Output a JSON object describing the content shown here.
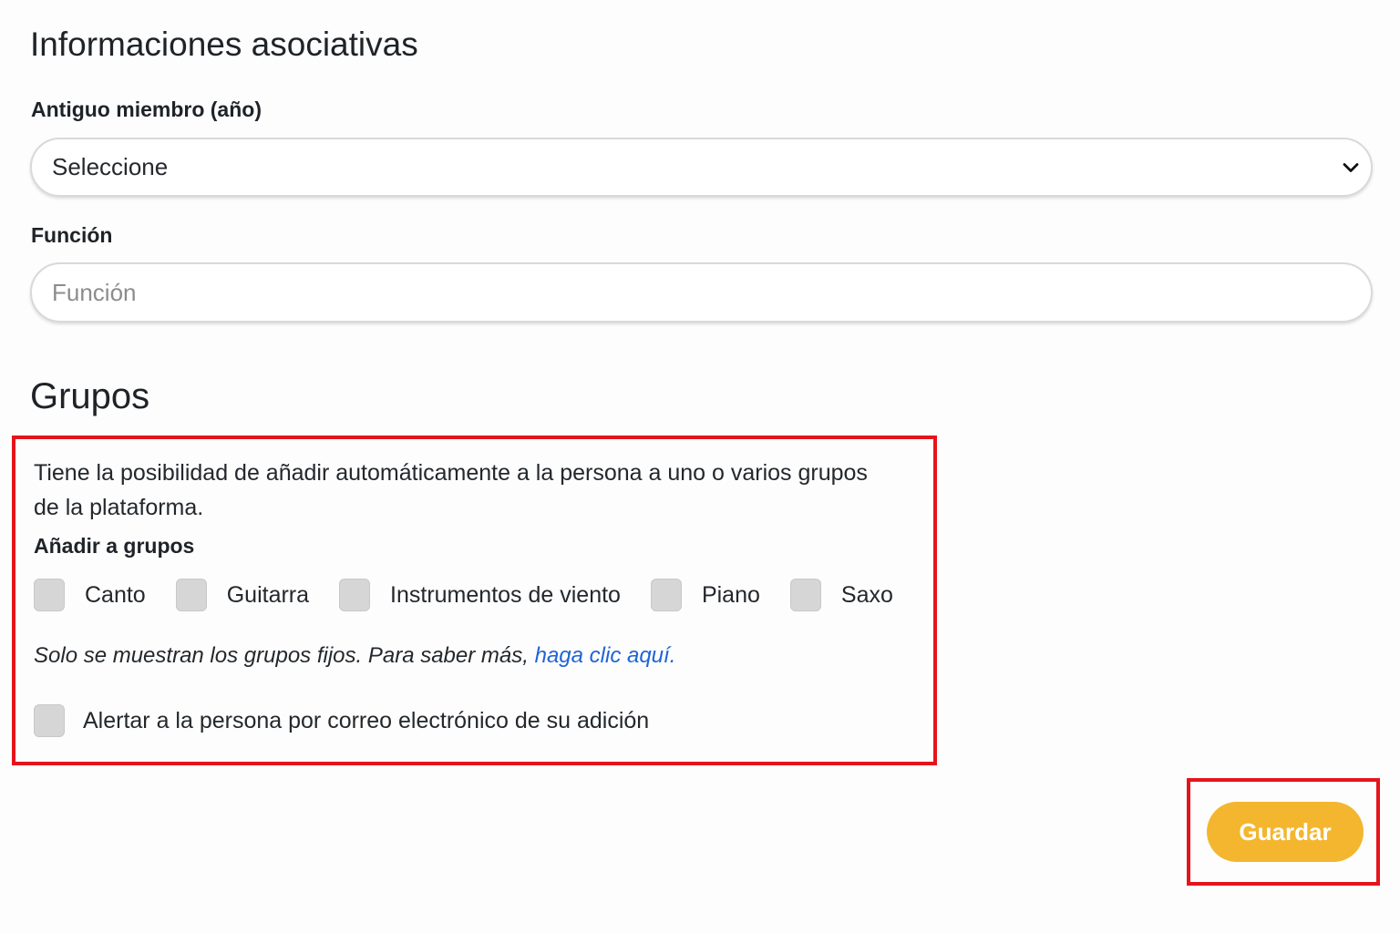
{
  "section_associative": {
    "title": "Informaciones asociativas",
    "former_member": {
      "label": "Antiguo miembro (año)",
      "selected_value": "Seleccione"
    },
    "function": {
      "label": "Función",
      "placeholder": "Función"
    }
  },
  "section_groups": {
    "title": "Grupos",
    "description": "Tiene la posibilidad de añadir automáticamente a la persona a uno o varios grupos de la plataforma.",
    "add_to_groups_label": "Añadir a grupos",
    "groups": [
      {
        "label": "Canto",
        "checked": false
      },
      {
        "label": "Guitarra",
        "checked": false
      },
      {
        "label": "Instrumentos de viento",
        "checked": false
      },
      {
        "label": "Piano",
        "checked": false
      },
      {
        "label": "Saxo",
        "checked": false
      }
    ],
    "note_text": "Solo se muestran los grupos fijos. Para saber más, ",
    "note_link": "haga clic aquí.",
    "notify": {
      "label": "Alertar a la persona por correo electrónico de su adición",
      "checked": false
    }
  },
  "actions": {
    "save_label": "Guardar"
  },
  "icons": {
    "select_chevron": "chevron-down-icon"
  },
  "colors": {
    "accent": "#f4b62f",
    "link": "#1f63d6",
    "highlight": "#e5141c",
    "checkbox": "#d6d6d6"
  }
}
